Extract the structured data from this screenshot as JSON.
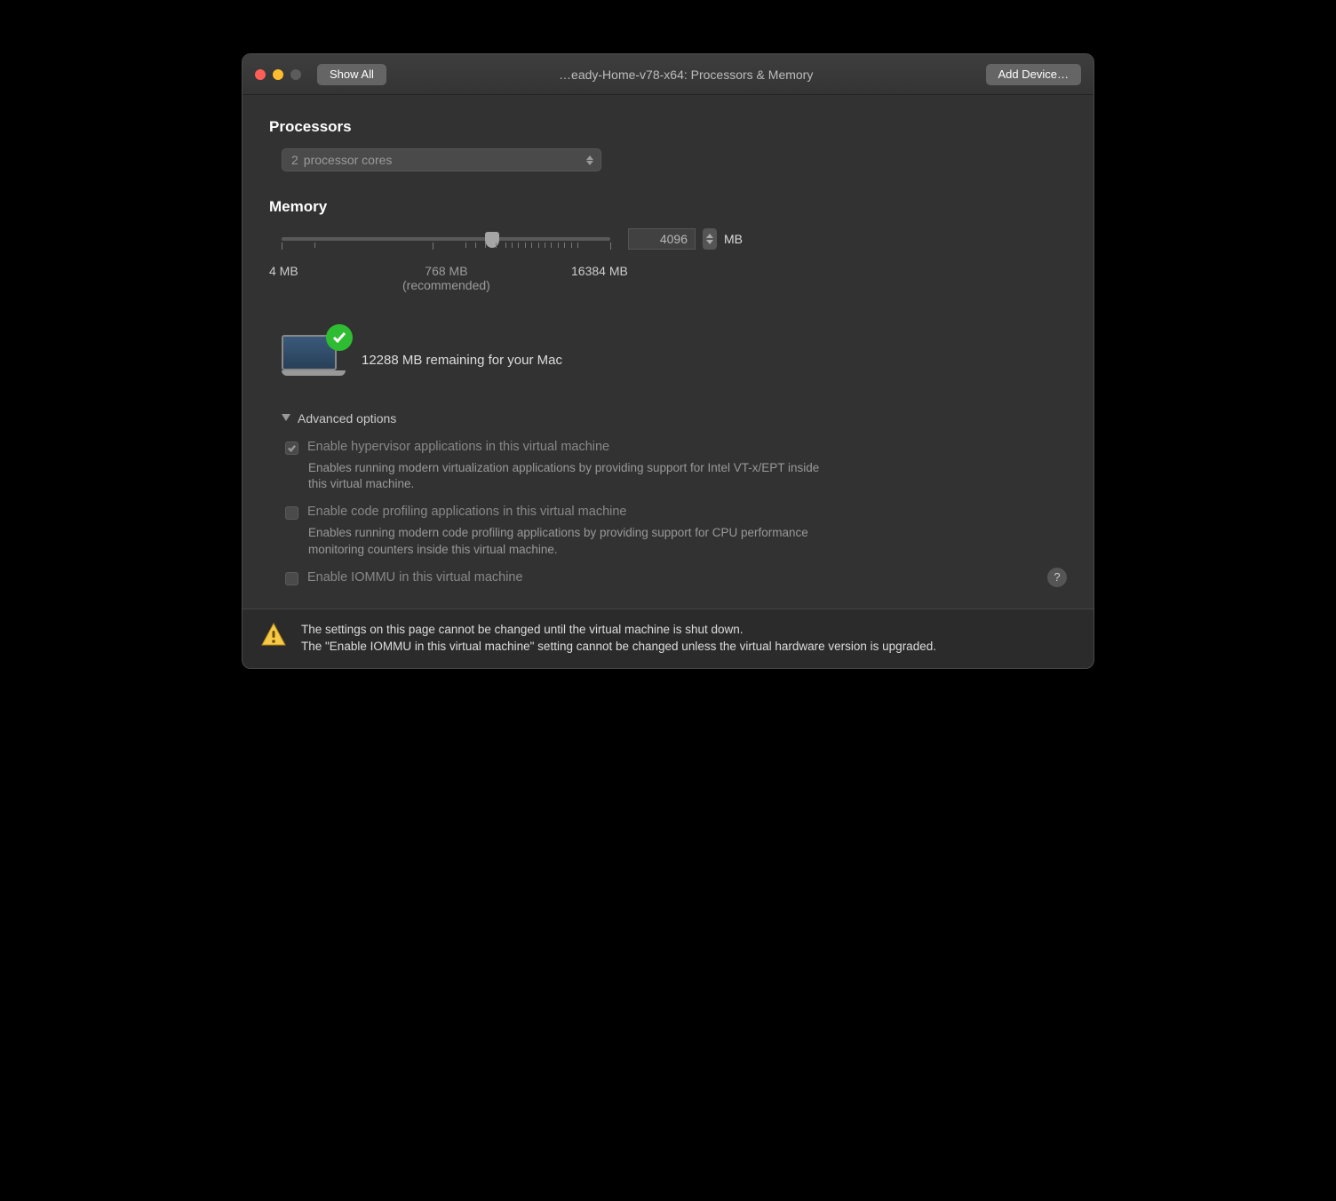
{
  "titlebar": {
    "show_all": "Show All",
    "title": "…eady-Home-v78-x64: Processors & Memory",
    "add_device": "Add Device…"
  },
  "processors": {
    "heading": "Processors",
    "value": "2",
    "suffix": "processor cores"
  },
  "memory": {
    "heading": "Memory",
    "value": "4096",
    "unit": "MB",
    "min_label": "4 MB",
    "recommended_value": "768 MB",
    "recommended_label": "(recommended)",
    "max_label": "16384 MB",
    "remaining": "12288 MB remaining for your Mac"
  },
  "advanced": {
    "header": "Advanced options",
    "opt1_label": "Enable hypervisor applications in this virtual machine",
    "opt1_desc": "Enables running modern virtualization applications by providing support for Intel VT-x/EPT inside this virtual machine.",
    "opt2_label": "Enable code profiling applications in this virtual machine",
    "opt2_desc": "Enables running modern code profiling applications by providing support for CPU performance monitoring counters inside this virtual machine.",
    "opt3_label": "Enable IOMMU in this virtual machine"
  },
  "footer": {
    "line1": "The settings on this page cannot be changed until the virtual machine is shut down.",
    "line2": "The \"Enable IOMMU in this virtual machine\" setting cannot be changed unless the virtual hardware version is upgraded."
  },
  "help": "?"
}
